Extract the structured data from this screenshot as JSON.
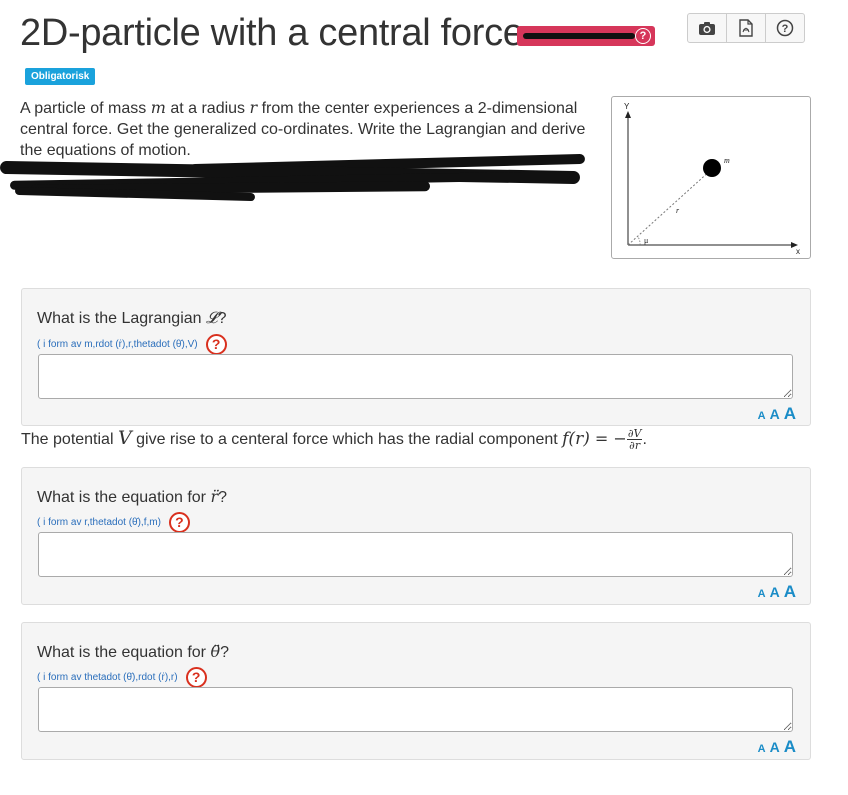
{
  "header": {
    "title": "2D-particle with a central force",
    "icons": [
      "camera-icon",
      "pdf-icon",
      "help-icon"
    ]
  },
  "badge": "Obligatorisk",
  "description": {
    "part1": "A particle of mass ",
    "m": "m",
    "part2": " at a radius ",
    "r": "r",
    "part3": " from the center experiences a 2-dimensional central force. Get the generalized co-ordinates. Write the Lagrangian and derive the equations of motion."
  },
  "diagram": {
    "y_label": "Y",
    "x_label": "x",
    "mass_label": "m",
    "r_label": "r",
    "angle_label": "μ"
  },
  "questions": [
    {
      "prefix": "What is the Lagrangian ",
      "symbol": "𝓛",
      "suffix": "?",
      "hint": "( i form av m,rdot (ṙ),r,thetadot (θ̇),V)",
      "answer": ""
    },
    {
      "prefix": "What is the equation for ",
      "symbol": "r̈",
      "suffix": "?",
      "hint": "( i form av r,thetadot (θ̇),f,m)",
      "answer": ""
    },
    {
      "prefix": "What is the equation for ",
      "symbol": "θ̈",
      "suffix": "?",
      "hint": "( i form av thetadot (θ̇),rdot (ṙ),r)",
      "answer": ""
    }
  ],
  "potential": {
    "part1": "The potential ",
    "V": "V",
    "part2": " give rise to a centeral force which has the radial component ",
    "fr": "f(r)",
    "eq": " = −",
    "num": "∂V",
    "den": "∂r",
    "end": "."
  },
  "font_sizer": [
    "A",
    "A",
    "A"
  ],
  "help_glyph": "?",
  "colors": {
    "badge": "#1aa2dc",
    "help_red": "#d9301e",
    "hint_blue": "#2a6ebb",
    "scribble_red": "#d6365a"
  }
}
